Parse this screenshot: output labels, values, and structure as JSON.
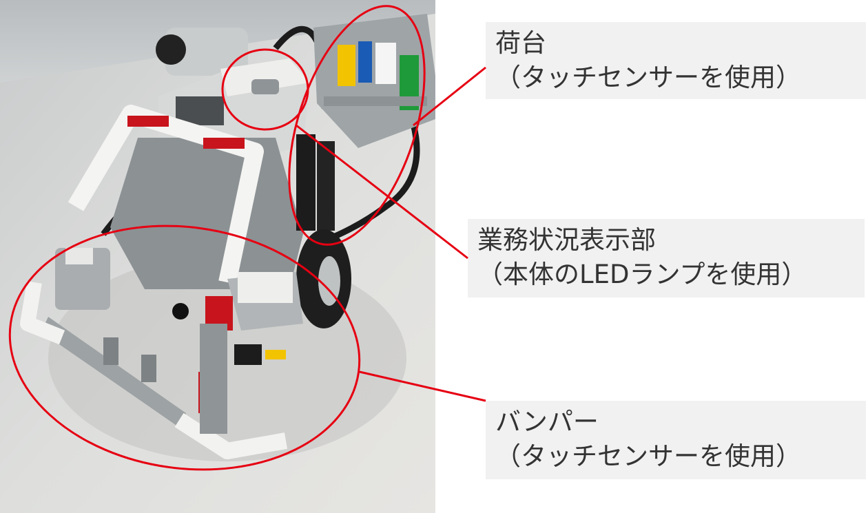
{
  "annotations": {
    "cargo": {
      "title": "荷台",
      "subtitle": "（タッチセンサーを使用）"
    },
    "status": {
      "title": "業務状況表示部",
      "subtitle": "（本体のLEDランプを使用）"
    },
    "bumper": {
      "title": "バンパー",
      "subtitle": "（タッチセンサーを使用）"
    }
  },
  "colors": {
    "highlight": "#e60012",
    "label_background": "#f1f1f1",
    "label_text": "#333333",
    "table_surface": "#dcdcd8",
    "robot_gray": "#9ea3a6",
    "robot_white": "#f3f3f1",
    "robot_red": "#c8141c",
    "robot_black": "#1c1c1c"
  }
}
